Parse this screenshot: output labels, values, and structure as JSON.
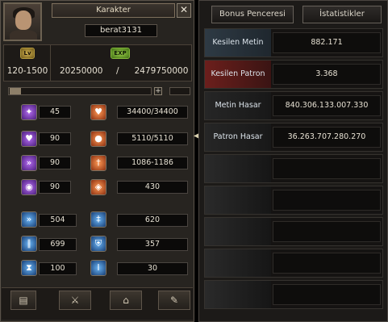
{
  "window": {
    "title": "Karakter",
    "close_label": "✕"
  },
  "character": {
    "name": "berat3131"
  },
  "level": {
    "badge": "Lv",
    "value": "120-1500"
  },
  "exp": {
    "badge": "EXP",
    "current": "20250000",
    "separator": "/",
    "max": "2479750000"
  },
  "controls": {
    "plus_label": "+"
  },
  "stats_left": [
    {
      "icon": "strength-icon",
      "value": "45"
    },
    {
      "icon": "heart-icon",
      "value": "90"
    },
    {
      "icon": "dexterity-icon",
      "value": "90"
    },
    {
      "icon": "intelligence-icon",
      "value": "90"
    }
  ],
  "stats_right": [
    {
      "icon": "hp-icon",
      "value": "34400/34400"
    },
    {
      "icon": "sp-icon",
      "value": "5110/5110"
    },
    {
      "icon": "attack-icon",
      "value": "1086-1186"
    },
    {
      "icon": "defense-icon",
      "value": "430"
    }
  ],
  "stats_bottom_left": [
    {
      "icon": "attack-speed-icon",
      "value": "504"
    },
    {
      "icon": "move-speed-icon",
      "value": "699"
    },
    {
      "icon": "hourglass-icon",
      "value": "100"
    }
  ],
  "stats_bottom_right": [
    {
      "icon": "magic-attack-icon",
      "value": "620"
    },
    {
      "icon": "magic-defense-icon",
      "value": "357"
    },
    {
      "icon": "evasion-icon",
      "value": "30"
    }
  ],
  "bottom_tabs": [
    {
      "icon": "character-card-icon"
    },
    {
      "icon": "crossed-swords-icon"
    },
    {
      "icon": "tent-icon"
    },
    {
      "icon": "quest-scroll-icon"
    }
  ],
  "right_tabs": {
    "bonus": "Bonus Penceresi",
    "stats": "İstatistikler"
  },
  "statistics": [
    {
      "label": "Kesilen Metin",
      "value": "882.171",
      "style": "metin"
    },
    {
      "label": "Kesilen Patron",
      "value": "3.368",
      "style": "red"
    },
    {
      "label": "Metin Hasar",
      "value": "840.306.133.007.330",
      "style": "dark"
    },
    {
      "label": "Patron Hasar",
      "value": "36.263.707.280.270",
      "style": "dark"
    },
    {
      "label": "",
      "value": "",
      "style": "empty"
    },
    {
      "label": "",
      "value": "",
      "style": "empty"
    },
    {
      "label": "",
      "value": "",
      "style": "empty"
    },
    {
      "label": "",
      "value": "",
      "style": "empty"
    },
    {
      "label": "",
      "value": "",
      "style": "empty"
    }
  ],
  "colors": {
    "panel": "#272420",
    "value_box": "#0b0a09",
    "accent_gold": "#d2b350",
    "exp_green": "#9fd24b",
    "boss_red": "#6c1f1c"
  }
}
